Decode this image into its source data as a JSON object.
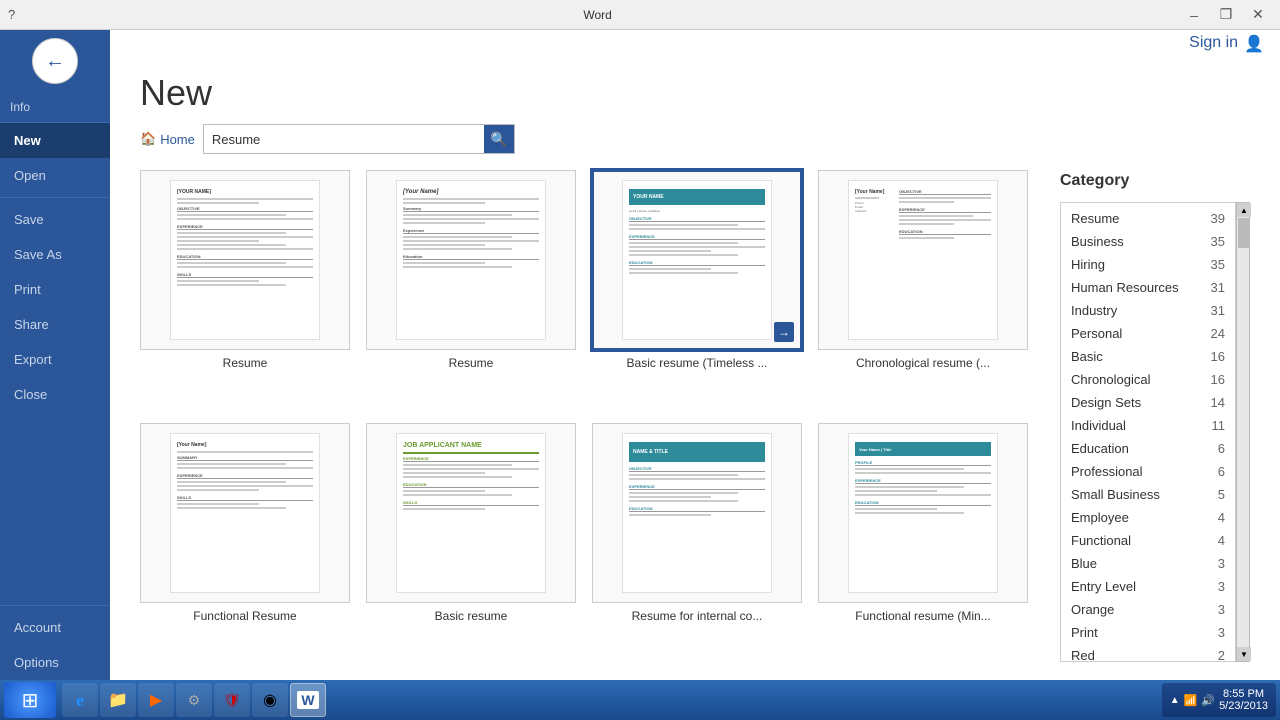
{
  "titlebar": {
    "title": "Word",
    "help": "?",
    "minimize": "–",
    "restore": "❐",
    "close": "✕"
  },
  "header": {
    "back_arrow": "←",
    "page_title": "New"
  },
  "sidebar": {
    "info_label": "Info",
    "items": [
      {
        "id": "new",
        "label": "New",
        "active": true
      },
      {
        "id": "open",
        "label": "Open",
        "active": false
      },
      {
        "id": "save",
        "label": "Save",
        "active": false
      },
      {
        "id": "save-as",
        "label": "Save As",
        "active": false
      },
      {
        "id": "print",
        "label": "Print",
        "active": false
      },
      {
        "id": "share",
        "label": "Share",
        "active": false
      },
      {
        "id": "export",
        "label": "Export",
        "active": false
      },
      {
        "id": "close",
        "label": "Close",
        "active": false
      },
      {
        "id": "account",
        "label": "Account",
        "active": false
      },
      {
        "id": "options",
        "label": "Options",
        "active": false
      }
    ]
  },
  "search": {
    "home_label": "Home",
    "placeholder": "Resume",
    "value": "Resume",
    "search_icon": "🔍"
  },
  "signin": {
    "label": "Sign in",
    "icon": "👤"
  },
  "templates": [
    {
      "id": 1,
      "label": "Resume",
      "selected": false,
      "style": "plain"
    },
    {
      "id": 2,
      "label": "Resume",
      "selected": false,
      "style": "plain2"
    },
    {
      "id": 3,
      "label": "Basic resume (Timeless ...",
      "selected": true,
      "style": "teal"
    },
    {
      "id": 4,
      "label": "Chronological resume (...",
      "selected": false,
      "style": "plain3"
    },
    {
      "id": 5,
      "label": "Functional Resume",
      "selected": false,
      "style": "plain4"
    },
    {
      "id": 6,
      "label": "Basic resume",
      "selected": false,
      "style": "green"
    },
    {
      "id": 7,
      "label": "Resume for internal co...",
      "selected": false,
      "style": "teal2"
    },
    {
      "id": 8,
      "label": "Functional resume (Min...",
      "selected": false,
      "style": "teal3"
    }
  ],
  "category": {
    "title": "Category",
    "items": [
      {
        "label": "Resume",
        "count": 39
      },
      {
        "label": "Business",
        "count": 35
      },
      {
        "label": "Hiring",
        "count": 35
      },
      {
        "label": "Human Resources",
        "count": 31
      },
      {
        "label": "Industry",
        "count": 31
      },
      {
        "label": "Personal",
        "count": 24
      },
      {
        "label": "Basic",
        "count": 16
      },
      {
        "label": "Chronological",
        "count": 16
      },
      {
        "label": "Design Sets",
        "count": 14
      },
      {
        "label": "Individual",
        "count": 11
      },
      {
        "label": "Education",
        "count": 6
      },
      {
        "label": "Professional",
        "count": 6
      },
      {
        "label": "Small Business",
        "count": 5
      },
      {
        "label": "Employee",
        "count": 4
      },
      {
        "label": "Functional",
        "count": 4
      },
      {
        "label": "Blue",
        "count": 3
      },
      {
        "label": "Entry Level",
        "count": 3
      },
      {
        "label": "Orange",
        "count": 3
      },
      {
        "label": "Print",
        "count": 3
      },
      {
        "label": "Red",
        "count": 2
      }
    ]
  },
  "taskbar": {
    "start_icon": "⊞",
    "apps": [
      {
        "id": "ie",
        "icon": "e",
        "label": "Internet Explorer"
      },
      {
        "id": "explorer",
        "icon": "📁",
        "label": "File Explorer"
      },
      {
        "id": "media",
        "icon": "▶",
        "label": "Media Player"
      },
      {
        "id": "app1",
        "icon": "⚙",
        "label": "App"
      },
      {
        "id": "app2",
        "icon": "🛡",
        "label": "Security"
      },
      {
        "id": "chrome",
        "icon": "◉",
        "label": "Chrome"
      },
      {
        "id": "word",
        "icon": "W",
        "label": "Word",
        "active": true
      }
    ],
    "tray": {
      "time": "8:55 PM",
      "date": "5/23/2013"
    }
  }
}
